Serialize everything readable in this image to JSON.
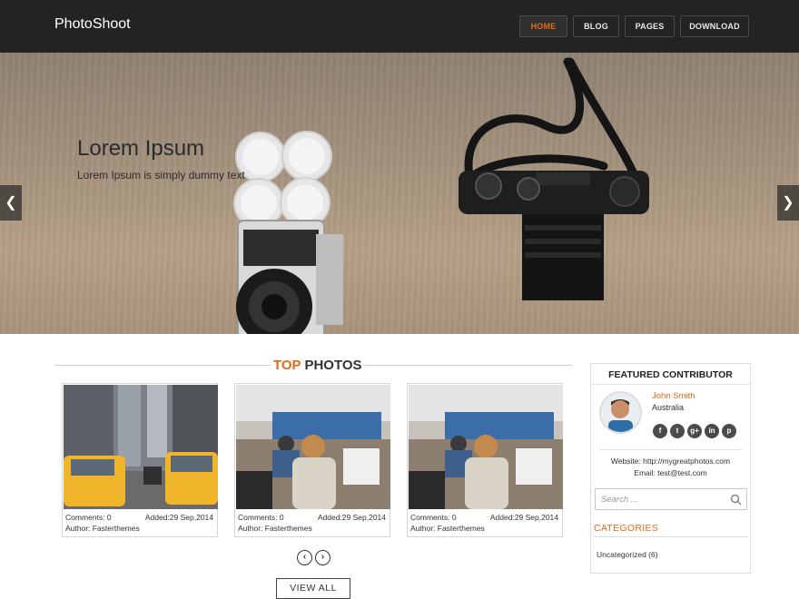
{
  "site": {
    "logo": "PhotoShoot"
  },
  "nav": {
    "items": [
      {
        "label": "HOME",
        "active": true
      },
      {
        "label": "BLOG",
        "active": false
      },
      {
        "label": "PAGES",
        "active": false
      },
      {
        "label": "DOWNLOAD",
        "active": false
      }
    ]
  },
  "hero": {
    "title": "Lorem Ipsum",
    "subtitle": "Lorem Ipsum is simply dummy text",
    "prev_icon": "chevron-left-icon",
    "next_icon": "chevron-right-icon"
  },
  "top_photos": {
    "title_accent": "TOP",
    "title_rest": " PHOTOS",
    "photos": [
      {
        "comments": "Comments: 0",
        "added": "Added:29 Sep,2014",
        "author": "Author: Fasterthemes"
      },
      {
        "comments": "Comments: 0",
        "added": "Added:29 Sep,2014",
        "author": "Author: Fasterthemes"
      },
      {
        "comments": "Comments: 0",
        "added": "Added:29 Sep,2014",
        "author": "Author: Fasterthemes"
      }
    ],
    "view_all": "VIEW ALL"
  },
  "sidebar": {
    "featured_title": "FEATURED CONTRIBUTOR",
    "contributor_name": "John Smith",
    "contributor_country": "Australia",
    "socials": [
      "f",
      "t",
      "g+",
      "in",
      "p"
    ],
    "website": "Website: http://mygreatphotos.com",
    "email": "Email: test@test.com",
    "search_placeholder": "Search ...",
    "categories_title": "CATEGORIES",
    "categories": [
      {
        "name": "Uncategorized",
        "count": "(6)",
        "label": "Uncategorized (6)"
      }
    ]
  },
  "colors": {
    "accent": "#e26a1b",
    "header_bg": "#232323"
  }
}
